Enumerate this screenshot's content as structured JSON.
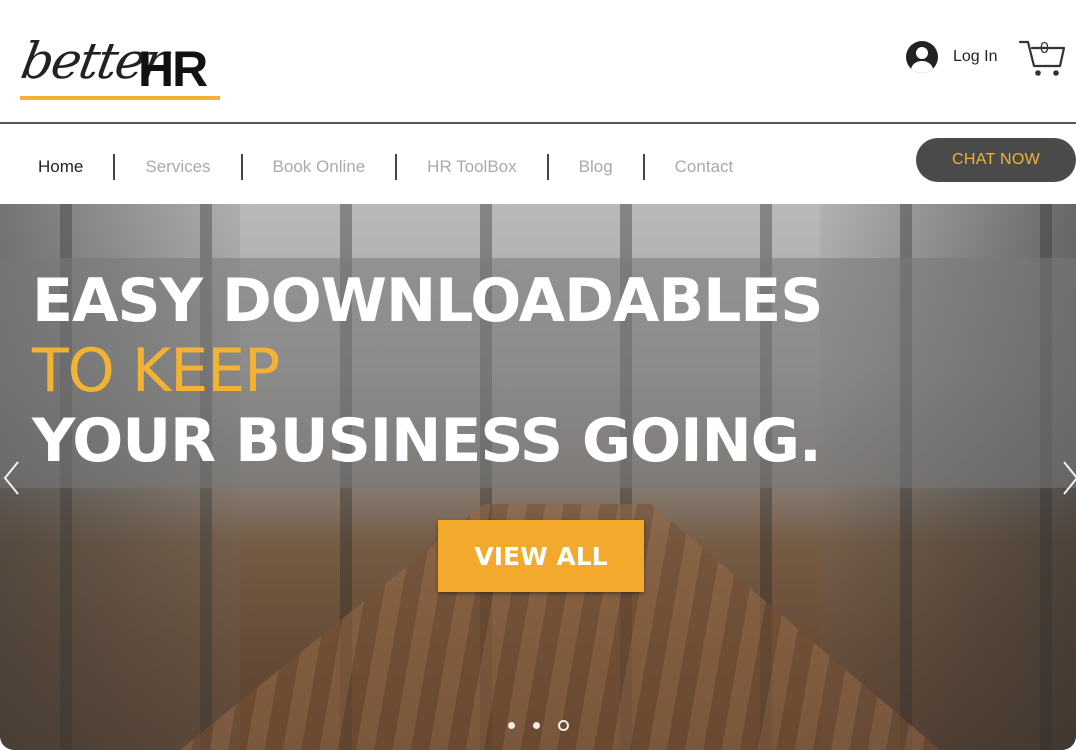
{
  "brand": {
    "logo_script": "better",
    "logo_bold": "HR",
    "accent_color": "#f2b233"
  },
  "header": {
    "login_label": "Log In",
    "cart_count": "0"
  },
  "nav": {
    "items": [
      {
        "label": "Home",
        "active": true
      },
      {
        "label": "Services",
        "active": false
      },
      {
        "label": "Book Online",
        "active": false
      },
      {
        "label": "HR ToolBox",
        "active": false
      },
      {
        "label": "Blog",
        "active": false
      },
      {
        "label": "Contact",
        "active": false
      }
    ],
    "chat_label": "CHAT NOW"
  },
  "hero": {
    "line1": "EASY DOWNLOADABLES",
    "line2": "TO KEEP",
    "line3": "YOUR BUSINESS GOING.",
    "cta_label": "VIEW ALL",
    "slides": 3,
    "active_slide": 3
  },
  "icons": {
    "avatar": "user-avatar-icon",
    "cart": "shopping-cart-icon",
    "prev": "chevron-left-icon",
    "next": "chevron-right-icon"
  }
}
